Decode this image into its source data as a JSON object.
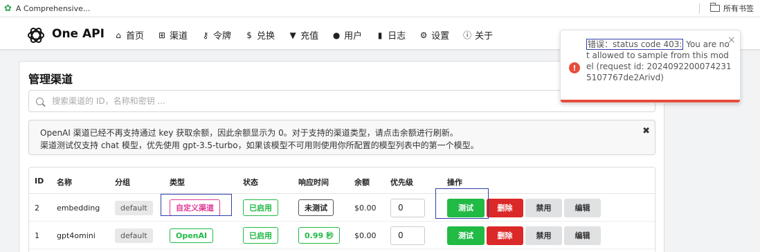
{
  "browser": {
    "bookmark_tab": "A Comprehensive...",
    "bookmarks_all": "所有书签"
  },
  "nav": {
    "brand": "One API",
    "items": [
      {
        "label": "首页",
        "icon": "home-icon"
      },
      {
        "label": "渠道",
        "icon": "sitemap-icon"
      },
      {
        "label": "令牌",
        "icon": "key-icon"
      },
      {
        "label": "兑换",
        "icon": "dollar-icon"
      },
      {
        "label": "充值",
        "icon": "cart-icon"
      },
      {
        "label": "用户",
        "icon": "user-icon"
      },
      {
        "label": "日志",
        "icon": "book-icon"
      },
      {
        "label": "设置",
        "icon": "gear-icon"
      },
      {
        "label": "关于",
        "icon": "info-icon"
      }
    ]
  },
  "page": {
    "title": "管理渠道",
    "search_placeholder": "搜索渠道的 ID，名称和密钥 ...",
    "notice_line1": "OpenAI 渠道已经不再支持通过 key 获取余额，因此余额显示为 0。对于支持的渠道类型，请点击余额进行刷新。",
    "notice_line2": "渠道测试仅支持 chat 模型，优先使用 gpt-3.5-turbo，如果该模型不可用则使用你所配置的模型列表中的第一个模型。"
  },
  "table": {
    "headers": [
      "ID",
      "名称",
      "分组",
      "类型",
      "状态",
      "响应时间",
      "余额",
      "优先级",
      "操作"
    ],
    "rows": [
      {
        "id": "2",
        "name": "embedding",
        "group": "default",
        "type": "自定义渠道",
        "status": "已启用",
        "response": "未测试",
        "balance": "$0.00",
        "priority": "0"
      },
      {
        "id": "1",
        "name": "gpt4omini",
        "group": "default",
        "type": "OpenAI",
        "status": "已启用",
        "response": "0.99 秒",
        "balance": "$0.00",
        "priority": "0"
      }
    ],
    "actions": {
      "test": "测试",
      "delete": "删除",
      "disable": "禁用",
      "edit": "编辑"
    }
  },
  "toast": {
    "prefix": "错误：status code 403:",
    "message": " You are not allowed to sample from this model (request id: 20240922000742315107767de2Arivd)",
    "close": "×"
  },
  "colors": {
    "green": "#21ba45",
    "red": "#db2828",
    "pink": "#e03997",
    "error": "#e74c3c",
    "highlight": "#2e3ea8"
  }
}
